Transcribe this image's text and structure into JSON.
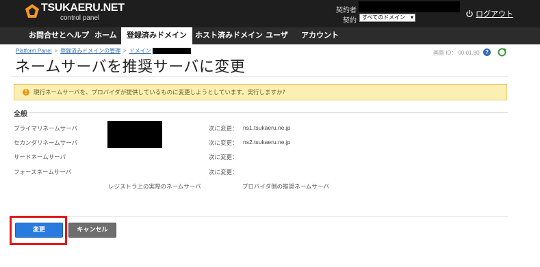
{
  "header": {
    "brand": "TSUKAERU.NET",
    "brand_sub": "control panel",
    "contract_holder_label": "契約者",
    "contract_label": "契約",
    "contract_select_value": "すべてのドメイン",
    "logout_label": "ログアウト"
  },
  "nav": {
    "items": [
      {
        "label": "お問合せとヘルプ"
      },
      {
        "label": "ホーム"
      },
      {
        "label": "登録済みドメイン"
      },
      {
        "label": "ホスト済みドメイン"
      },
      {
        "label": "ユーザ"
      },
      {
        "label": "アカウント"
      }
    ],
    "active_index": 2
  },
  "breadcrumb": {
    "items": [
      "Platform Panel",
      "登録済みドメインの管理",
      "ドメイン"
    ],
    "separator": ">"
  },
  "screen_id": "画面 ID： 00.01.80",
  "page_title": "ネームサーバを推奨サーバに変更",
  "warning": {
    "text": "現行ネームサーバを、プロバイダが提供しているものに変更しようとしています。実行しますか?"
  },
  "section": {
    "title": "全般",
    "rows": [
      {
        "label": "プライマリネームサーバ",
        "next_label": "次に変更：",
        "next_value": "ns1.tsukaeru.ne.jp"
      },
      {
        "label": "セカンダリネームサーバ",
        "next_label": "次に変更：",
        "next_value": "ns2.tsukaeru.ne.jp"
      },
      {
        "label": "サードネームサーバ",
        "next_label": "次に変更：",
        "next_value": ""
      },
      {
        "label": "フォースネームサーバ",
        "next_label": "次に変更：",
        "next_value": ""
      }
    ],
    "caption_left": "レジストラ上の実際のネームサーバ",
    "caption_right": "プロバイダ側の推奨ネームサーバ"
  },
  "buttons": {
    "submit": "変更",
    "cancel": "キャンセル"
  },
  "colors": {
    "topbar": "#1e1e1e",
    "navbar": "#2c2c2c",
    "primary": "#2a7be0",
    "warning_bg": "#fcefb4",
    "highlight": "#e01919"
  }
}
